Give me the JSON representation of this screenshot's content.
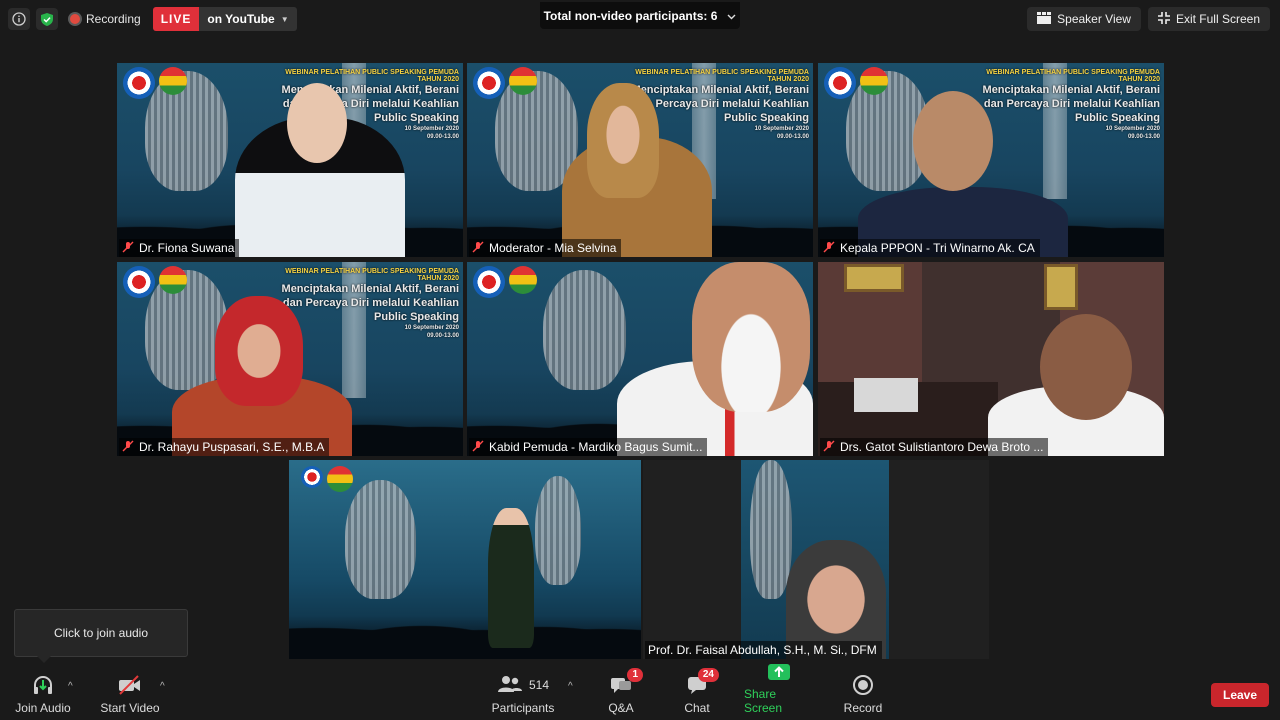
{
  "top_bar": {
    "recording_label": "Recording",
    "live_label": "LIVE",
    "stream_target": "on YouTube",
    "non_video_participants": "Total non-video participants: 6",
    "speaker_view_label": "Speaker View",
    "exit_fullscreen_label": "Exit Full Screen"
  },
  "banner": {
    "header": "WEBINAR PELATIHAN PUBLIC SPEAKING PEMUDA",
    "year": "TAHUN 2020",
    "line1": "Menciptakan Milenial Aktif, Berani",
    "line2": "dan Percaya Diri melalui Keahlian",
    "line3": "Public Speaking",
    "date": "10 September 2020",
    "time": "09.00-13.00"
  },
  "participants": [
    {
      "name": "Dr. Fiona Suwana",
      "muted": true
    },
    {
      "name": "Moderator - Mia Selvina",
      "muted": true
    },
    {
      "name": "Kepala PPPON - Tri Winarno Ak. CA",
      "muted": true
    },
    {
      "name": "Dr. Rahayu Puspasari, S.E., M.B.A",
      "muted": true
    },
    {
      "name": "Kabid Pemuda - Mardiko Bagus Sumit...",
      "muted": true
    },
    {
      "name": "Drs. Gatot Sulistiantoro Dewa Broto ...",
      "muted": true
    },
    {
      "name": "",
      "muted": false,
      "active_speaker": true
    },
    {
      "name": "Prof. Dr. Faisal Abdullah, S.H., M. Si., DFM",
      "muted": false
    }
  ],
  "toast": {
    "text": "Click to join audio"
  },
  "toolbar": {
    "join_audio": "Join Audio",
    "start_video": "Start Video",
    "participants_label": "Participants",
    "participants_count": "514",
    "qa_label": "Q&A",
    "qa_badge": "1",
    "chat_label": "Chat",
    "chat_badge": "24",
    "share_label": "Share Screen",
    "record_label": "Record",
    "leave_label": "Leave"
  },
  "colors": {
    "live": "#e0303a",
    "share_green": "#23c05b",
    "active_border": "#b9e27a",
    "leave": "#c9262c"
  }
}
